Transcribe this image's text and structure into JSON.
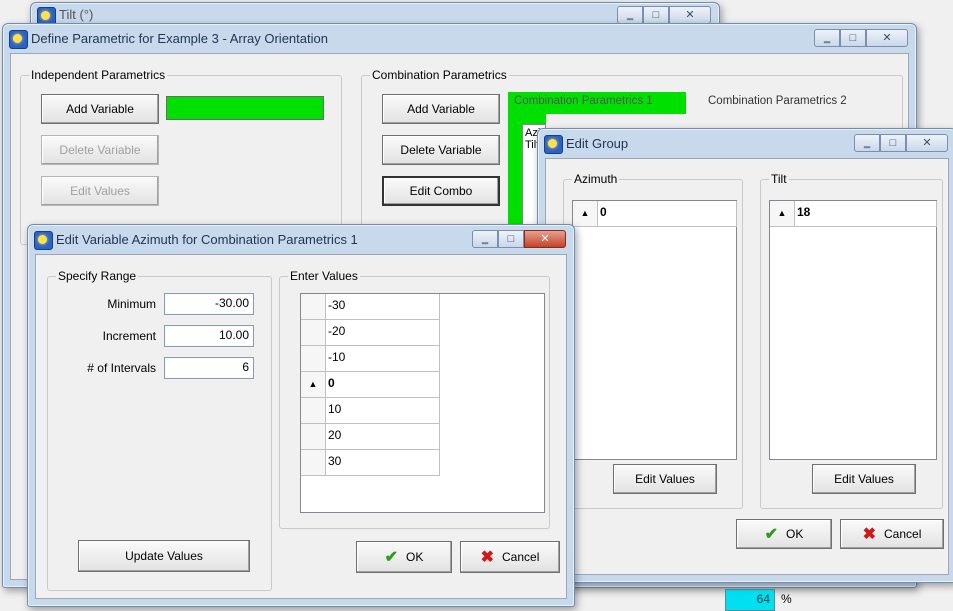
{
  "tilt_window": {
    "title": "Tilt (°)"
  },
  "main_window": {
    "title": "Define Parametric for Example 3 - Array Orientation",
    "independent": {
      "group_label": "Independent Parametrics",
      "add_variable": "Add Variable",
      "delete_variable": "Delete Variable",
      "edit_values": "Edit Values"
    },
    "combination": {
      "group_label": "Combination Parametrics",
      "add_variable": "Add Variable",
      "delete_variable": "Delete Variable",
      "edit_combo": "Edit Combo",
      "tabs": [
        "Combination Parametrics 1",
        "Combination Parametrics 2"
      ],
      "list_items": [
        "Azi",
        "Tilt"
      ]
    },
    "peek_value": "64",
    "peek_unit": "%"
  },
  "edit_group": {
    "title": "Edit Group",
    "azimuth": {
      "label": "Azimuth",
      "value": "0",
      "button": "Edit Values"
    },
    "tilt": {
      "label": "Tilt",
      "value": "18",
      "button": "Edit Values"
    },
    "ok": "OK",
    "cancel": "Cancel"
  },
  "edit_variable": {
    "title": "Edit Variable Azimuth for Combination Parametrics 1",
    "range": {
      "label": "Specify Range",
      "minimum_label": "Minimum",
      "minimum": "-30.00",
      "increment_label": "Increment",
      "increment": "10.00",
      "intervals_label": "# of Intervals",
      "intervals": "6"
    },
    "enter_values_label": "Enter Values",
    "values": [
      "-30",
      "-20",
      "-10",
      "0",
      "10",
      "20",
      "30"
    ],
    "update_values": "Update Values",
    "ok": "OK",
    "cancel": "Cancel"
  },
  "colors": {
    "green_highlight": "#00e000",
    "cyan_field": "#00e0f0"
  }
}
